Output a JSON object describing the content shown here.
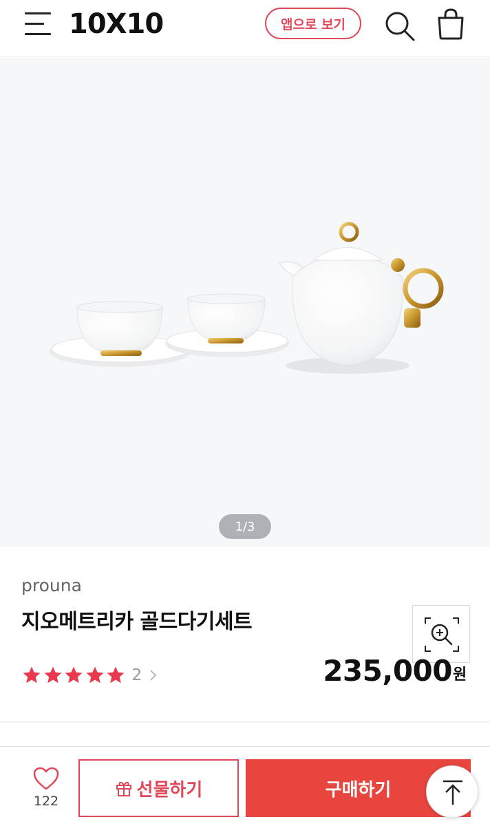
{
  "header": {
    "logo": "10X10",
    "app_button": "앱으로 보기",
    "icons": [
      "menu-icon",
      "search-icon",
      "shopping-bag-icon"
    ]
  },
  "gallery": {
    "pager": "1/3"
  },
  "product": {
    "brand": "prouna",
    "title": "지오메트리카 골드다기세트",
    "rating_stars": 5,
    "review_count": "2",
    "price": "235,000",
    "currency": "원"
  },
  "bottom_bar": {
    "like_count": "122",
    "gift_label": "선물하기",
    "buy_label": "구매하기"
  },
  "colors": {
    "accent": "#e0485a",
    "buy_button": "#e9453f",
    "star": "#e8394e",
    "hero_bg": "#f5f7f9"
  }
}
